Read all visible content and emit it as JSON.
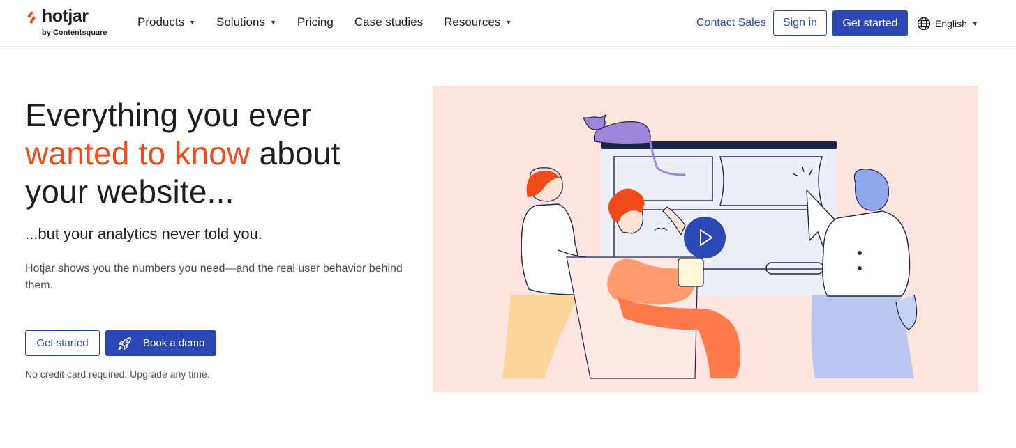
{
  "brand": {
    "name": "hotjar",
    "byline": "by Contentsquare",
    "accent_color": "#f04a1a",
    "primary_color": "#2c47b6"
  },
  "nav": {
    "items": [
      {
        "label": "Products",
        "has_dropdown": true
      },
      {
        "label": "Solutions",
        "has_dropdown": true
      },
      {
        "label": "Pricing",
        "has_dropdown": false
      },
      {
        "label": "Case studies",
        "has_dropdown": false
      },
      {
        "label": "Resources",
        "has_dropdown": true
      }
    ],
    "contact_sales": "Contact Sales",
    "sign_in": "Sign in",
    "get_started": "Get started",
    "language": "English"
  },
  "hero": {
    "headline_part1": "Everything you ever",
    "headline_accent": "wanted to know",
    "headline_part2": "about",
    "headline_part3": "your website...",
    "subheadline": "...but your analytics never told you.",
    "description": "Hotjar shows you the numbers you need—and the real user behavior behind them.",
    "cta_primary": "Get started",
    "cta_demo": "Book a demo",
    "note": "No credit card required. Upgrade any time."
  },
  "illustration": {
    "background": "#fde4de",
    "play_button_color": "#2c47b6"
  }
}
